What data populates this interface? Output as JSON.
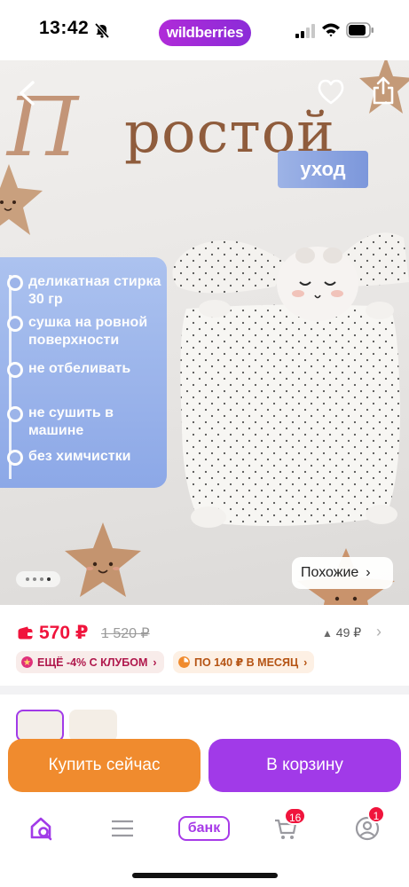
{
  "status_bar": {
    "time": "13:42",
    "brand": "wildberries",
    "icons": [
      "bell-off-icon",
      "signal-icon",
      "wifi-icon",
      "battery-icon"
    ]
  },
  "product_image": {
    "title_first_letter": "П",
    "title_rest": "ростой",
    "subtitle": "уход",
    "care_items": [
      "деликатная стирка 30 гр",
      "сушка на ровной поверхности",
      "не отбеливать",
      "не сушить в машине",
      "без химчистки"
    ],
    "gallery_total": 4,
    "gallery_active": 4,
    "similar_label": "Похожие",
    "similar_chevron": "›"
  },
  "price": {
    "current": "570 ₽",
    "old": "1 520 ₽",
    "rating_change": "49 ₽",
    "chevron": "›"
  },
  "chips": {
    "club": "ЕЩЁ -4% С КЛУБОМ",
    "installment": "ПО 140 ₽ В МЕСЯЦ",
    "chevron": "›"
  },
  "actions": {
    "buy_now": "Купить сейчас",
    "add_to_cart": "В корзину"
  },
  "tab_bar": {
    "bank_label": "банк",
    "cart_badge": "16",
    "profile_badge": "1"
  },
  "colors": {
    "accent_purple": "#a13ae8",
    "accent_orange": "#f08b2e",
    "price_red": "#f0143c"
  }
}
